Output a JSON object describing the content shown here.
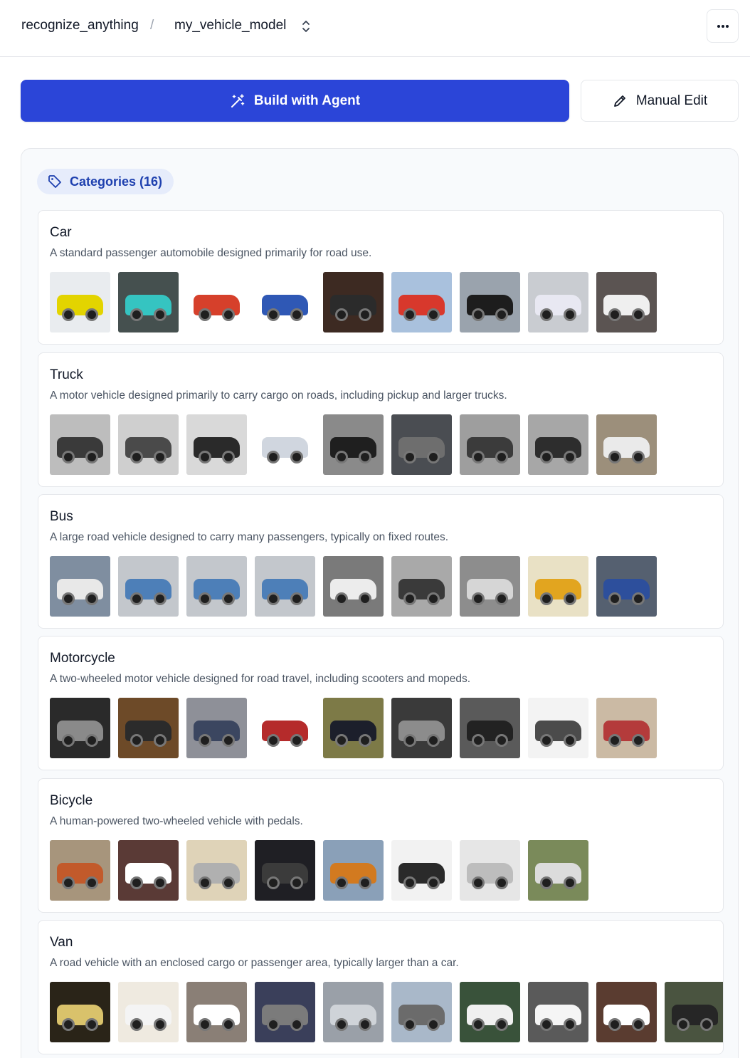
{
  "breadcrumb": {
    "project": "recognize_anything",
    "separator": "/",
    "model": "my_vehicle_model"
  },
  "actions": {
    "agent_label": "Build with Agent",
    "manual_label": "Manual Edit"
  },
  "categories_badge": "Categories (16)",
  "colors": {
    "accent": "#2b45d8",
    "badge_bg": "#e6ecfb",
    "badge_text": "#1e40af"
  },
  "categories": [
    {
      "name": "Car",
      "description": "A standard passenger automobile designed primarily for road use.",
      "thumbs": [
        {
          "bg": "#e9ecef",
          "body": "#e3d400"
        },
        {
          "bg": "#45504f",
          "body": "#35c4c1"
        },
        {
          "bg": "#ffffff",
          "body": "#d6402b"
        },
        {
          "bg": "#ffffff",
          "body": "#2f58b5"
        },
        {
          "bg": "#3d2a22",
          "body": "#2b2b2b"
        },
        {
          "bg": "#a9c1dd",
          "body": "#d8382c"
        },
        {
          "bg": "#9aa3ad",
          "body": "#1d1d1d"
        },
        {
          "bg": "#c9ccd1",
          "body": "#e8e8f2"
        },
        {
          "bg": "#5b5452",
          "body": "#efefef"
        }
      ]
    },
    {
      "name": "Truck",
      "description": "A motor vehicle designed primarily to carry cargo on roads, including pickup and larger trucks.",
      "thumbs": [
        {
          "bg": "#bdbdbd",
          "body": "#3a3a3a"
        },
        {
          "bg": "#cfcfcf",
          "body": "#4a4a4a"
        },
        {
          "bg": "#d9d9d9",
          "body": "#2a2a2a"
        },
        {
          "bg": "#ffffff",
          "body": "#d0d6df"
        },
        {
          "bg": "#8a8a8a",
          "body": "#1f1f1f"
        },
        {
          "bg": "#4a4d52",
          "body": "#6e6e6e"
        },
        {
          "bg": "#9e9e9e",
          "body": "#3b3b3b"
        },
        {
          "bg": "#a7a7a7",
          "body": "#2d2d2d"
        },
        {
          "bg": "#9c8f7b",
          "body": "#eaeaea"
        }
      ]
    },
    {
      "name": "Bus",
      "description": "A large road vehicle designed to carry many passengers, typically on fixed routes.",
      "thumbs": [
        {
          "bg": "#7f8ea0",
          "body": "#e8e8e8"
        },
        {
          "bg": "#c3c7cc",
          "body": "#4d7fb8"
        },
        {
          "bg": "#c3c7cc",
          "body": "#4d7fb8"
        },
        {
          "bg": "#c3c7cc",
          "body": "#4d7fb8"
        },
        {
          "bg": "#7a7a7a",
          "body": "#ececec"
        },
        {
          "bg": "#a9a9a9",
          "body": "#3a3a3a"
        },
        {
          "bg": "#8d8d8d",
          "body": "#d6d6d6"
        },
        {
          "bg": "#e9e1c5",
          "body": "#e2a51f"
        },
        {
          "bg": "#556070",
          "body": "#2d4f9c"
        }
      ]
    },
    {
      "name": "Motorcycle",
      "description": "A two-wheeled motor vehicle designed for road travel, including scooters and mopeds.",
      "thumbs": [
        {
          "bg": "#2a2a2a",
          "body": "#8a8a8a"
        },
        {
          "bg": "#6d4a28",
          "body": "#2b2b2b"
        },
        {
          "bg": "#8e9098",
          "body": "#3b4660"
        },
        {
          "bg": "#ffffff",
          "body": "#b52b2b"
        },
        {
          "bg": "#7d7a47",
          "body": "#1c1f2b"
        },
        {
          "bg": "#3a3a3a",
          "body": "#8c8c8c"
        },
        {
          "bg": "#5a5a5a",
          "body": "#222222"
        },
        {
          "bg": "#f3f3f3",
          "body": "#4b4b4b"
        },
        {
          "bg": "#cbbaa4",
          "body": "#b43b3b"
        }
      ]
    },
    {
      "name": "Bicycle",
      "description": "A human-powered two-wheeled vehicle with pedals.",
      "thumbs": [
        {
          "bg": "#a7957c",
          "body": "#c25a2b"
        },
        {
          "bg": "#5a3a36",
          "body": "#ffffff"
        },
        {
          "bg": "#dfd3b8",
          "body": "#b0b0b0"
        },
        {
          "bg": "#1f1f24",
          "body": "#3b3b3b"
        },
        {
          "bg": "#8aa0b8",
          "body": "#d27a20"
        },
        {
          "bg": "#f2f2f2",
          "body": "#2a2a2a"
        },
        {
          "bg": "#e6e6e6",
          "body": "#bdbdbd"
        },
        {
          "bg": "#7a8a5a",
          "body": "#dcdcdc"
        }
      ]
    },
    {
      "name": "Van",
      "description": "A road vehicle with an enclosed cargo or passenger area, typically larger than a car.",
      "thumbs": [
        {
          "bg": "#2a2418",
          "body": "#d9c26b"
        },
        {
          "bg": "#efeae0",
          "body": "#f4f4f4"
        },
        {
          "bg": "#8a7f76",
          "body": "#ffffff"
        },
        {
          "bg": "#3a3f5a",
          "body": "#7b7b7b"
        },
        {
          "bg": "#9aa0a8",
          "body": "#cfd3d8"
        },
        {
          "bg": "#a9b8c9",
          "body": "#6b6b6b"
        },
        {
          "bg": "#39523a",
          "body": "#f0f0f0"
        },
        {
          "bg": "#5a5a5a",
          "body": "#f5f5f5"
        },
        {
          "bg": "#5a3c30",
          "body": "#ffffff"
        },
        {
          "bg": "#4a5440",
          "body": "#262626"
        }
      ]
    }
  ]
}
